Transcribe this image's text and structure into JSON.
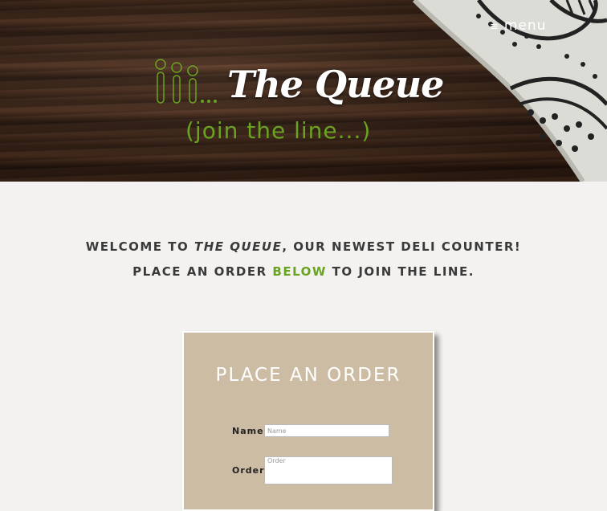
{
  "header": {
    "menu_icon": "hamburger-icon",
    "menu_label": "menu",
    "logo_icon": "queue-people-icon",
    "title": "The Queue",
    "tagline": "(join the line...)"
  },
  "welcome": {
    "line1_prefix": "WELCOME TO ",
    "line1_em": "THE QUEUE",
    "line1_suffix": ", OUR NEWEST DELI COUNTER!",
    "line2_prefix": "PLACE AN ORDER ",
    "line2_highlight": "BELOW",
    "line2_suffix": " TO JOIN THE LINE."
  },
  "order_form": {
    "title": "PLACE AN ORDER",
    "name_label": "Name:",
    "name_placeholder": "Name",
    "order_label": "Order:",
    "order_placeholder": "Order"
  },
  "colors": {
    "accent_green": "#6aa321",
    "card_background": "#cdbca4",
    "page_background": "#f3f2f0"
  }
}
